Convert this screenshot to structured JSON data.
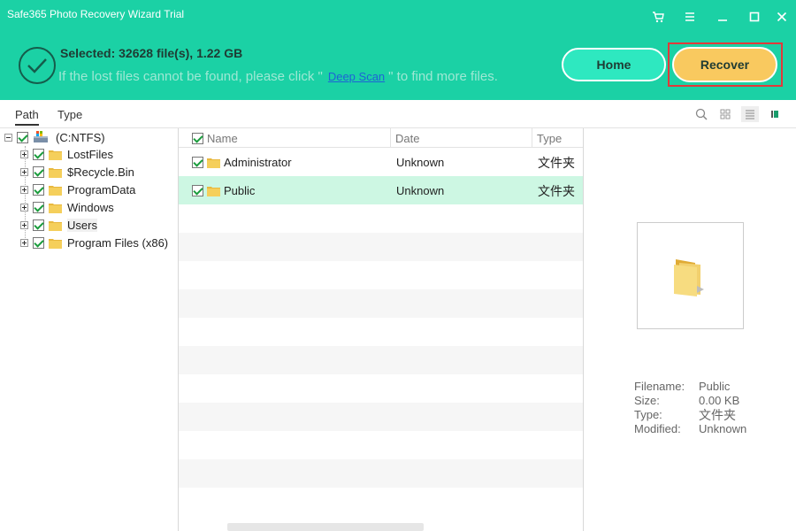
{
  "window": {
    "title": "Safe365 Photo Recovery Wizard Trial"
  },
  "header": {
    "selected": "Selected: 32628 file(s), 1.22 GB",
    "hint_before": "If the lost files cannot be found, please click \"",
    "deep_scan": "Deep Scan",
    "hint_after": "\" to find more files.",
    "home_label": "Home",
    "recover_label": "Recover"
  },
  "tabs": [
    {
      "label": "Path"
    },
    {
      "label": "Type"
    }
  ],
  "tree": {
    "root": "(C:NTFS)",
    "items": [
      {
        "label": "LostFiles"
      },
      {
        "label": "$Recycle.Bin"
      },
      {
        "label": "ProgramData"
      },
      {
        "label": "Windows"
      },
      {
        "label": "Users"
      },
      {
        "label": "Program Files (x86)"
      }
    ]
  },
  "list": {
    "columns": {
      "name": "Name",
      "date": "Date",
      "type": "Type"
    },
    "rows": [
      {
        "name": "Administrator",
        "date": "Unknown",
        "type": "文件夹"
      },
      {
        "name": "Public",
        "date": "Unknown",
        "type": "文件夹"
      }
    ]
  },
  "details": {
    "filename_label": "Filename:",
    "filename": "Public",
    "size_label": "Size:",
    "size": "0.00 KB",
    "type_label": "Type:",
    "type": "文件夹",
    "modified_label": "Modified:",
    "modified": "Unknown"
  },
  "colors": {
    "header": "#1bd1a5",
    "recover": "#f9c95f",
    "home": "#2ee8c0",
    "selected_row": "#cdf7e3",
    "highlight": "#e2393a"
  },
  "icons": [
    "cart-icon",
    "menu-icon",
    "minimize-icon",
    "maximize-icon",
    "close-icon",
    "check-circle-icon",
    "search-icon",
    "grid-view-icon",
    "list-view-icon",
    "preview-pane-icon",
    "folder-icon",
    "drive-icon"
  ]
}
